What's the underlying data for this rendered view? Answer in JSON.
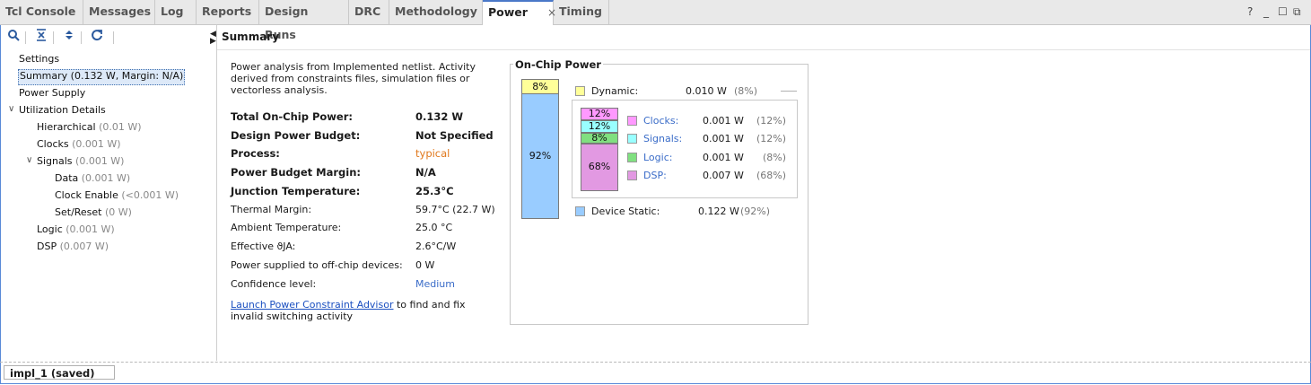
{
  "tabs": [
    {
      "label": "Tcl Console"
    },
    {
      "label": "Messages"
    },
    {
      "label": "Log"
    },
    {
      "label": "Reports"
    },
    {
      "label": "Design Runs"
    },
    {
      "label": "DRC"
    },
    {
      "label": "Methodology"
    },
    {
      "label": "Power",
      "close": "×"
    },
    {
      "label": "Timing"
    }
  ],
  "window_controls": {
    "help": "?",
    "minimize": "_",
    "maximize": "☐",
    "restore": "⧉"
  },
  "toolbar_icons": [
    "search-icon",
    "collapse-all-icon",
    "expand-all-icon",
    "refresh-icon"
  ],
  "tree": {
    "settings": "Settings",
    "summary": "Summary (0.132 W, Margin: N/A)",
    "power_supply": "Power Supply",
    "utilization": "Utilization Details",
    "hierarchical": {
      "label": "Hierarchical",
      "value": "(0.01 W)"
    },
    "clocks": {
      "label": "Clocks",
      "value": "(0.001 W)"
    },
    "signals": {
      "label": "Signals",
      "value": "(0.001 W)"
    },
    "data": {
      "label": "Data",
      "value": "(0.001 W)"
    },
    "clock_enable": {
      "label": "Clock Enable",
      "value": "(<0.001 W)"
    },
    "set_reset": {
      "label": "Set/Reset",
      "value": "(0 W)"
    },
    "logic": {
      "label": "Logic",
      "value": "(0.001 W)"
    },
    "dsp": {
      "label": "DSP",
      "value": "(0.007 W)"
    }
  },
  "summary": {
    "heading": "Summary",
    "description": "Power analysis from Implemented netlist. Activity derived from constraints files, simulation files or vectorless analysis.",
    "rows": [
      {
        "key": "Total On-Chip Power:",
        "value": "0.132 W"
      },
      {
        "key": "Design Power Budget:",
        "value": "Not Specified"
      },
      {
        "key": "Process:",
        "value": "typical"
      },
      {
        "key": "Power Budget Margin:",
        "value": "N/A"
      },
      {
        "key": "Junction Temperature:",
        "value": "25.3°C"
      },
      {
        "key": "Thermal Margin:",
        "value": "59.7°C (22.7 W)"
      },
      {
        "key": "Ambient Temperature:",
        "value": "25.0 °C"
      },
      {
        "key": "Effective ϑJA:",
        "value": "2.6°C/W"
      },
      {
        "key": "Power supplied to off-chip devices:",
        "value": "0 W"
      },
      {
        "key": "Confidence level:",
        "value": "Medium"
      }
    ],
    "link_text": "Launch Power Constraint Advisor",
    "link_suffix": " to find and fix invalid switching activity"
  },
  "on_chip": {
    "title": "On-Chip Power",
    "dynamic": {
      "label": "Dynamic:",
      "value": "0.010 W",
      "pct": "(8%)",
      "bar": "8%",
      "color": "#ffff99"
    },
    "static": {
      "label": "Device Static:",
      "value": "0.122 W",
      "pct": "(92%)",
      "bar": "92%",
      "color": "#99ccff"
    },
    "breakdown": [
      {
        "label": "Clocks:",
        "value": "0.001 W",
        "pct": "(12%)",
        "bar": "12%",
        "color": "#ff99ff"
      },
      {
        "label": "Signals:",
        "value": "0.001 W",
        "pct": "(12%)",
        "bar": "12%",
        "color": "#99ffff"
      },
      {
        "label": "Logic:",
        "value": "0.001 W",
        "pct": "(8%)",
        "bar": "8%",
        "color": "#80e080"
      },
      {
        "label": "DSP:",
        "value": "0.007 W",
        "pct": "(68%)",
        "bar": "68%",
        "color": "#e299e2"
      }
    ]
  },
  "status": {
    "run": "impl_1 (saved)"
  }
}
